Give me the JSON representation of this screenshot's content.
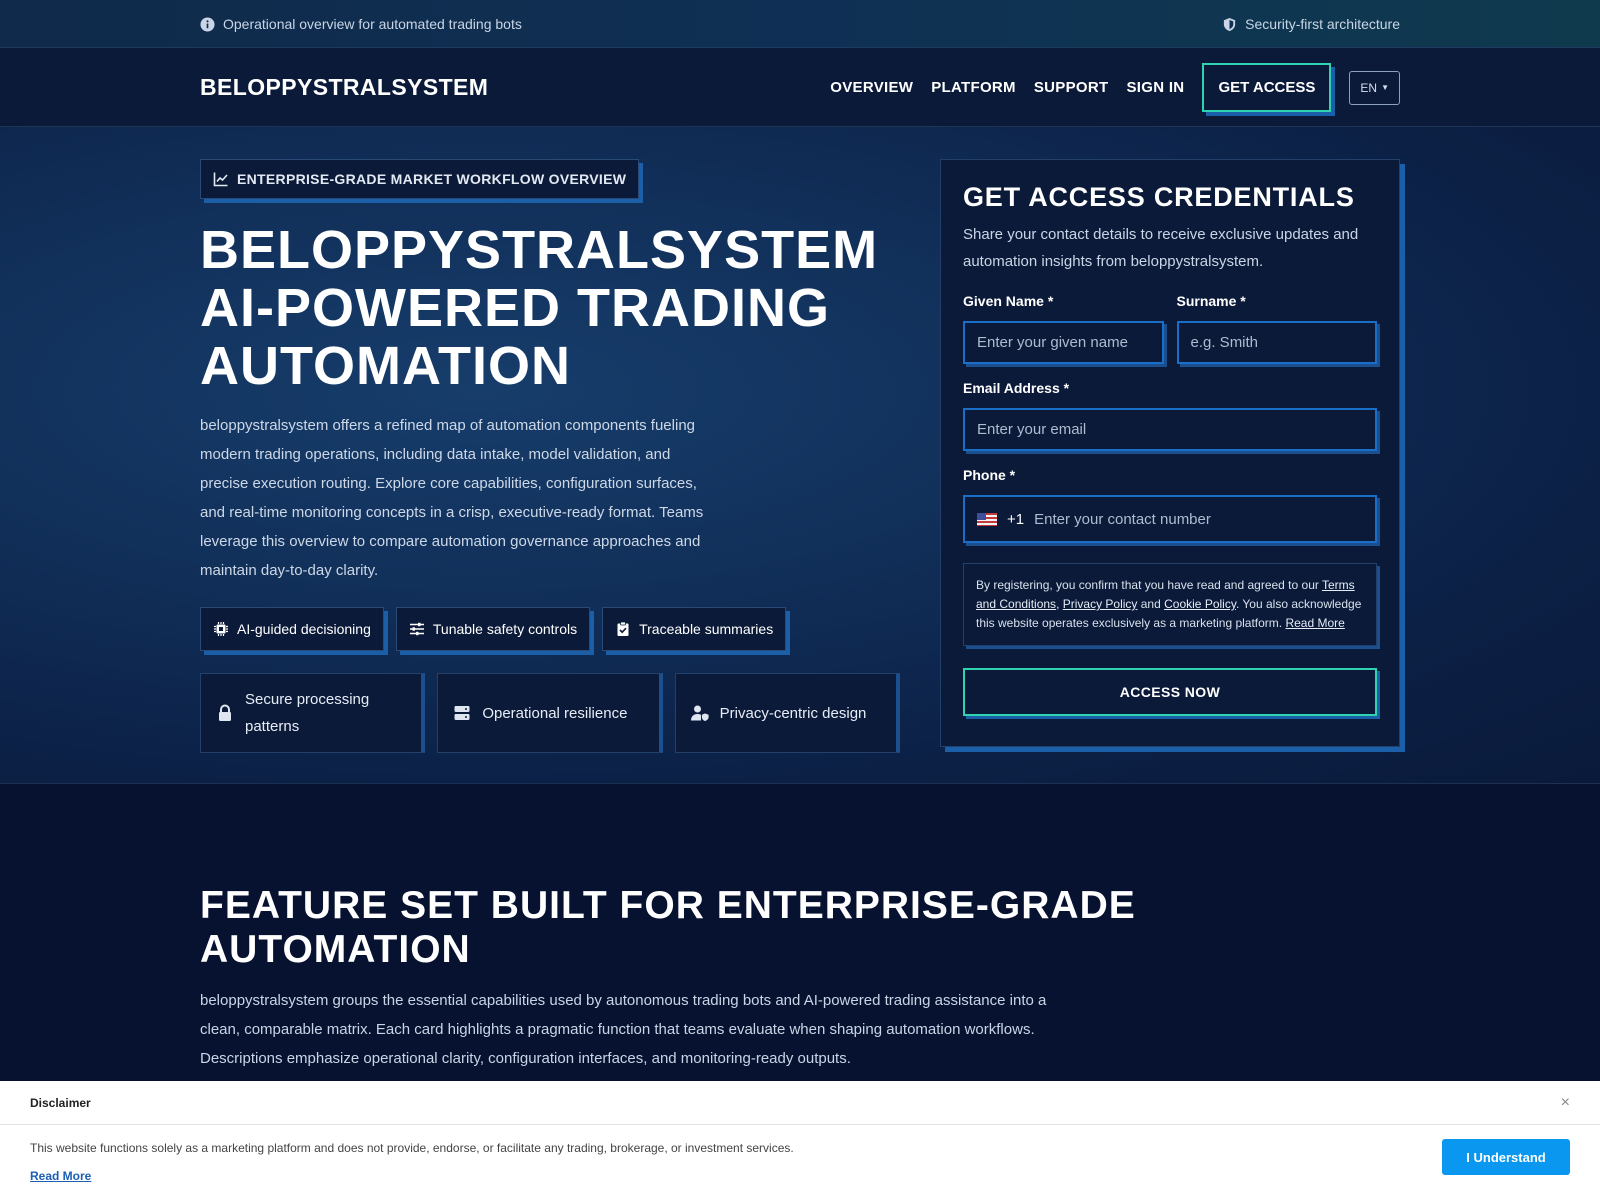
{
  "topbar": {
    "left_text": "Operational overview for automated trading bots",
    "right_text": "Security-first architecture"
  },
  "nav": {
    "brand": "BELOPPYSTRALSYSTEM",
    "links": [
      "OVERVIEW",
      "PLATFORM",
      "SUPPORT",
      "SIGN IN"
    ],
    "cta": "GET ACCESS",
    "lang": "EN"
  },
  "hero": {
    "eyebrow": "ENTERPRISE-GRADE MARKET WORKFLOW OVERVIEW",
    "title": "BELOPPYSTRALSYSTEM AI-POWERED TRADING AUTOMATION",
    "lead": "beloppystralsystem offers a refined map of automation components fueling modern trading operations, including data intake, model validation, and precise execution routing. Explore core capabilities, configuration surfaces, and real-time monitoring concepts in a crisp, executive-ready format. Teams leverage this overview to compare automation governance approaches and maintain day-to-day clarity.",
    "chips": [
      "AI-guided decisioning",
      "Tunable safety controls",
      "Traceable summaries"
    ],
    "tiles": [
      "Secure processing patterns",
      "Operational resilience",
      "Privacy-centric design"
    ]
  },
  "form": {
    "title": "GET ACCESS CREDENTIALS",
    "subtitle": "Share your contact details to receive exclusive updates and automation insights from beloppystralsystem.",
    "given_label": "Given Name *",
    "given_placeholder": "Enter your given name",
    "surname_label": "Surname *",
    "surname_placeholder": "e.g. Smith",
    "email_label": "Email Address *",
    "email_placeholder": "Enter your email",
    "phone_label": "Phone *",
    "phone_code": "+1",
    "phone_placeholder": "Enter your contact number",
    "consent_prefix": "By registering, you confirm that you have read and agreed to our ",
    "terms": "Terms and Conditions",
    "sep1": ", ",
    "privacy": "Privacy Policy",
    "sep2": " and ",
    "cookie": "Cookie Policy",
    "consent_suffix": ". You also acknowledge this website operates exclusively as a marketing platform. ",
    "read_more": "Read More",
    "submit": "ACCESS NOW"
  },
  "features": {
    "title": "FEATURE SET BUILT FOR ENTERPRISE-GRADE AUTOMATION",
    "text": "beloppystralsystem groups the essential capabilities used by autonomous trading bots and AI-powered trading assistance into a clean, comparable matrix. Each card highlights a pragmatic function that teams evaluate when shaping automation workflows. Descriptions emphasize operational clarity, configuration interfaces, and monitoring-ready outputs."
  },
  "disclaimer": {
    "title": "Disclaimer",
    "close": "×",
    "text": "This website functions solely as a marketing platform and does not provide, endorse, or facilitate any trading, brokerage, or investment services.",
    "link": "Read More",
    "button": "I Understand"
  },
  "colors": {
    "accent": "#2fd3b0",
    "shadow_blue": "#1b5fa8",
    "navy": "#0b1a38",
    "button_blue": "#0a97f0"
  }
}
